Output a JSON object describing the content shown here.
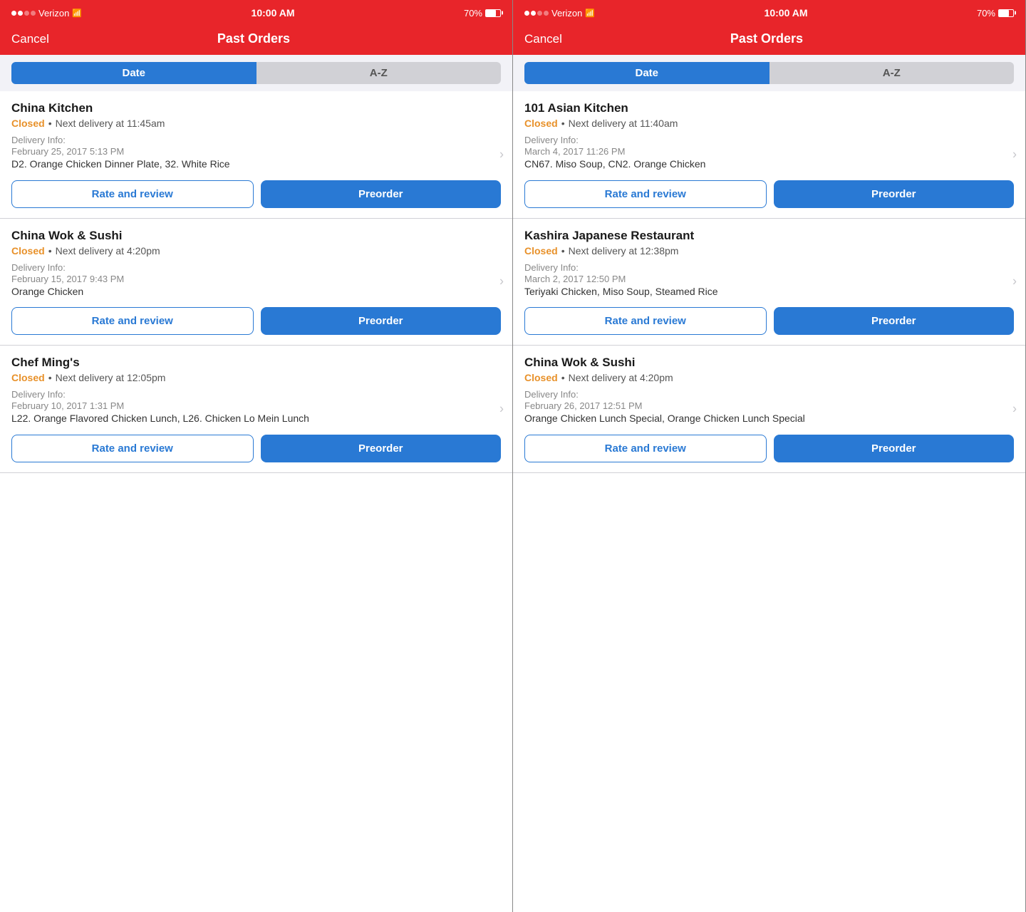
{
  "panels": [
    {
      "id": "left",
      "statusBar": {
        "carrier": "Verizon",
        "time": "10:00 AM",
        "battery": "70%"
      },
      "navBar": {
        "cancel": "Cancel",
        "title": "Past Orders"
      },
      "segments": {
        "date": "Date",
        "az": "A-Z",
        "active": "date"
      },
      "orders": [
        {
          "name": "China Kitchen",
          "status": "Closed",
          "nextDelivery": "Next delivery at 11:45am",
          "deliveryInfoLabel": "Delivery Info:",
          "deliveryDate": "February 25, 2017 5:13 PM",
          "deliveryItems": "D2. Orange Chicken Dinner Plate, 32. White Rice",
          "rateLabel": "Rate and review",
          "preorderLabel": "Preorder"
        },
        {
          "name": "China Wok & Sushi",
          "status": "Closed",
          "nextDelivery": "Next delivery at 4:20pm",
          "deliveryInfoLabel": "Delivery Info:",
          "deliveryDate": "February 15, 2017 9:43 PM",
          "deliveryItems": "Orange Chicken",
          "rateLabel": "Rate and review",
          "preorderLabel": "Preorder"
        },
        {
          "name": "Chef Ming's",
          "status": "Closed",
          "nextDelivery": "Next delivery at 12:05pm",
          "deliveryInfoLabel": "Delivery Info:",
          "deliveryDate": "February 10, 2017 1:31 PM",
          "deliveryItems": "L22. Orange Flavored Chicken Lunch, L26. Chicken Lo Mein Lunch",
          "rateLabel": "Rate and review",
          "preorderLabel": "Preorder"
        }
      ]
    },
    {
      "id": "right",
      "statusBar": {
        "carrier": "Verizon",
        "time": "10:00 AM",
        "battery": "70%"
      },
      "navBar": {
        "cancel": "Cancel",
        "title": "Past Orders"
      },
      "segments": {
        "date": "Date",
        "az": "A-Z",
        "active": "date"
      },
      "orders": [
        {
          "name": "101 Asian Kitchen",
          "status": "Closed",
          "nextDelivery": "Next delivery at 11:40am",
          "deliveryInfoLabel": "Delivery Info:",
          "deliveryDate": "March 4, 2017 11:26 PM",
          "deliveryItems": "CN67. Miso Soup, CN2. Orange Chicken",
          "rateLabel": "Rate and review",
          "preorderLabel": "Preorder"
        },
        {
          "name": "Kashira Japanese Restaurant",
          "status": "Closed",
          "nextDelivery": "Next delivery at 12:38pm",
          "deliveryInfoLabel": "Delivery Info:",
          "deliveryDate": "March 2, 2017 12:50 PM",
          "deliveryItems": "Teriyaki Chicken, Miso Soup, Steamed Rice",
          "rateLabel": "Rate and review",
          "preorderLabel": "Preorder"
        },
        {
          "name": "China Wok & Sushi",
          "status": "Closed",
          "nextDelivery": "Next delivery at 4:20pm",
          "deliveryInfoLabel": "Delivery Info:",
          "deliveryDate": "February 26, 2017 12:51 PM",
          "deliveryItems": "Orange Chicken Lunch Special, Orange Chicken Lunch Special",
          "rateLabel": "Rate and review",
          "preorderLabel": "Preorder"
        }
      ]
    }
  ],
  "colors": {
    "accent": "#e8252a",
    "blue": "#2979d4",
    "orange": "#e8912a"
  }
}
